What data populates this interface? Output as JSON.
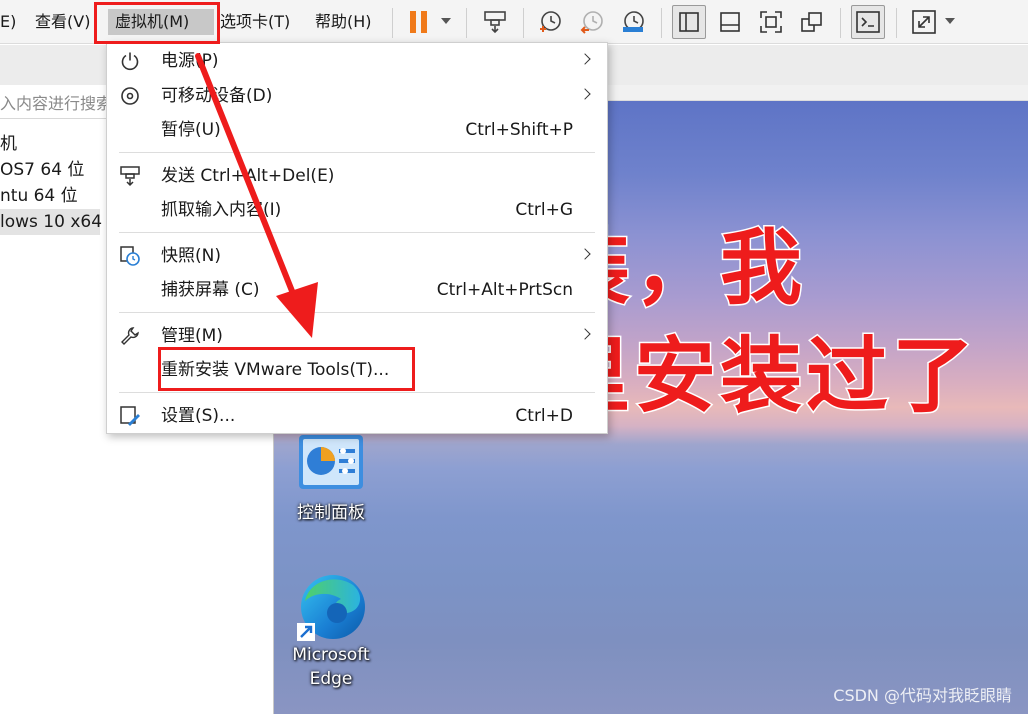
{
  "menubar": {
    "items": [
      {
        "label": "E)"
      },
      {
        "label": "查看(V)"
      },
      {
        "label": "虚拟机(M)"
      },
      {
        "label": "选项卡(T)"
      },
      {
        "label": "帮助(H)"
      }
    ]
  },
  "library": {
    "search_placeholder": "入内容进行搜索",
    "items": [
      {
        "label": "机"
      },
      {
        "label": "OS7 64 位"
      },
      {
        "label": "ntu 64 位"
      },
      {
        "label": "lows 10 x64"
      }
    ]
  },
  "vm_menu": {
    "items": [
      {
        "label": "电源(P)",
        "shortcut": ""
      },
      {
        "label": "可移动设备(D)",
        "shortcut": ""
      },
      {
        "label": "暂停(U)",
        "shortcut": "Ctrl+Shift+P"
      },
      {
        "label": "发送 Ctrl+Alt+Del(E)",
        "shortcut": ""
      },
      {
        "label": "抓取输入内容(I)",
        "shortcut": "Ctrl+G"
      },
      {
        "label": "快照(N)",
        "shortcut": ""
      },
      {
        "label": "捕获屏幕 (C)",
        "shortcut": "Ctrl+Alt+PrtScn"
      },
      {
        "label": "管理(M)",
        "shortcut": ""
      },
      {
        "label": "重新安装 VMware Tools(T)...",
        "shortcut": ""
      },
      {
        "label": "设置(S)...",
        "shortcut": "Ctrl+D"
      }
    ]
  },
  "desktop": {
    "icons": [
      {
        "label": "控制面板"
      },
      {
        "label": "Microsoft Edge"
      }
    ]
  },
  "annotation": {
    "line1": "安装，我",
    "line2": "这里安装过了",
    "color": "#ee1c1c"
  },
  "watermark": "CSDN @代码对我眨眼睛"
}
